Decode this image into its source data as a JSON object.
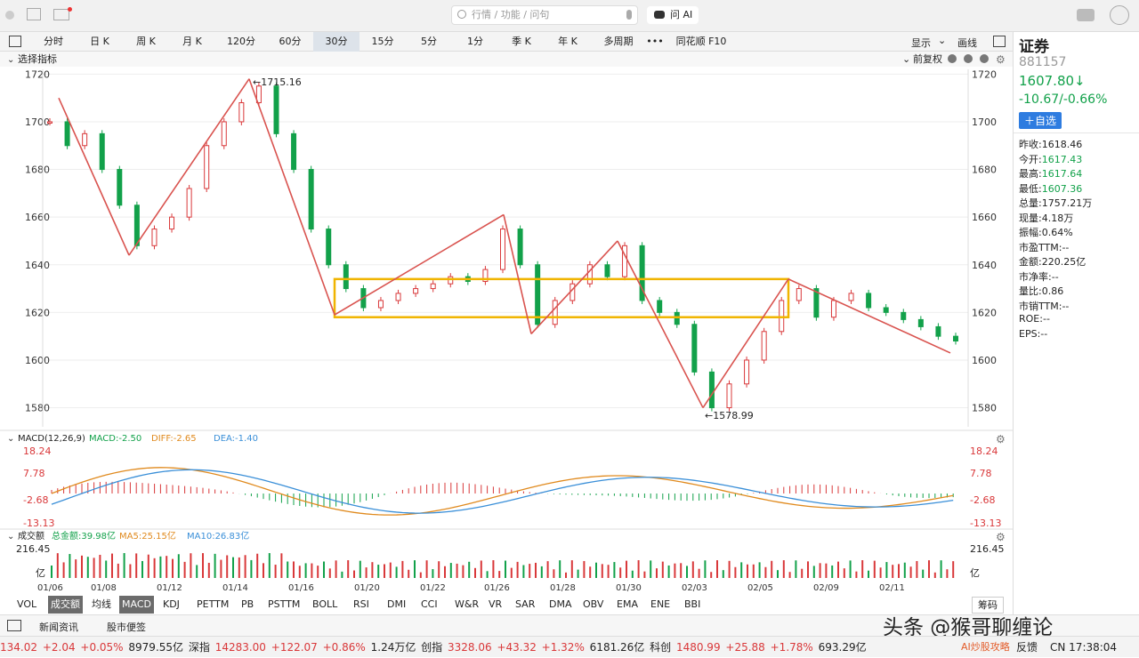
{
  "toolbar": {
    "search_placeholder": "行情 / 功能 / 问句",
    "ask_ai": "问 AI"
  },
  "period_tabs": [
    "分时",
    "日 K",
    "周 K",
    "月 K",
    "120分",
    "60分",
    "30分",
    "15分",
    "5分",
    "1分",
    "季 K",
    "年 K",
    "多周期",
    "•••",
    "同花顺 F10"
  ],
  "active_tab": "30分",
  "tab_right": {
    "display": "显示",
    "draw": "画线"
  },
  "indicator_bar": {
    "select": "选择指标",
    "fuquan": "前复权"
  },
  "stock": {
    "name": "证券",
    "code": "881157",
    "price": "1607.80↓",
    "change": "-10.67/-0.66%",
    "add_btn": "＋自选"
  },
  "quote": [
    {
      "label": "昨收:",
      "value": "1618.46",
      "color": "#222"
    },
    {
      "label": "今开:",
      "value": "1617.43",
      "color": "#12a14a"
    },
    {
      "label": "最高:",
      "value": "1617.64",
      "color": "#12a14a"
    },
    {
      "label": "最低:",
      "value": "1607.36",
      "color": "#12a14a"
    },
    {
      "label": "总量:",
      "value": "1757.21万",
      "color": "#222"
    },
    {
      "label": "现量:",
      "value": "4.18万",
      "color": "#222"
    },
    {
      "label": "振幅:",
      "value": "0.64%",
      "color": "#222"
    },
    {
      "label": "市盈TTM:",
      "value": "--",
      "color": "#222"
    },
    {
      "label": "金额:",
      "value": "220.25亿",
      "color": "#222"
    },
    {
      "label": "市净率:",
      "value": "--",
      "color": "#222"
    },
    {
      "label": "量比:",
      "value": "0.86",
      "color": "#222"
    },
    {
      "label": "市销TTM:",
      "value": "--",
      "color": "#222"
    },
    {
      "label": "ROE:",
      "value": "--",
      "color": "#222"
    },
    {
      "label": "EPS:",
      "value": "--",
      "color": "#222"
    }
  ],
  "chart_data": [
    {
      "type": "candlestick",
      "title": "",
      "y_ticks": [
        1580,
        1600,
        1620,
        1640,
        1660,
        1680,
        1700,
        1720
      ],
      "ylim": [
        1572,
        1722
      ],
      "annotations": {
        "high": "←1715.16",
        "low": "←1578.99"
      },
      "x_dates": [
        "01/06",
        "01/08",
        "01/12",
        "01/14",
        "01/16",
        "01/20",
        "01/22",
        "01/26",
        "01/28",
        "01/30",
        "02/03",
        "02/05",
        "02/09",
        "02/11"
      ],
      "close_path": [
        1700,
        1690,
        1695,
        1680,
        1665,
        1648,
        1655,
        1660,
        1672,
        1690,
        1700,
        1708,
        1715,
        1695,
        1680,
        1655,
        1640,
        1630,
        1622,
        1625,
        1628,
        1630,
        1632,
        1635,
        1633,
        1638,
        1655,
        1640,
        1615,
        1625,
        1632,
        1640,
        1635,
        1648,
        1625,
        1620,
        1615,
        1595,
        1580,
        1590,
        1600,
        1612,
        1625,
        1630,
        1618,
        1625,
        1628,
        1622,
        1620,
        1617,
        1614,
        1610,
        1608
      ]
    },
    {
      "type": "line",
      "title": "MACD(12,26,9)",
      "legend": [
        {
          "name": "MACD:-2.50",
          "color": "#12a14a"
        },
        {
          "name": "DIFF:-2.65",
          "color": "#e08a1e"
        },
        {
          "name": "DEA:-1.40",
          "color": "#3a8fd8"
        }
      ],
      "y_ticks": [
        18.24,
        7.78,
        -2.68,
        -13.13
      ]
    },
    {
      "type": "bar",
      "title": "成交额",
      "legend": [
        {
          "name": "总金额:39.98亿",
          "color": "#12a14a"
        },
        {
          "name": "MA5:25.15亿",
          "color": "#e08a1e"
        },
        {
          "name": "MA10:26.83亿",
          "color": "#3a8fd8"
        }
      ],
      "y_ticks": [
        "216.45",
        "亿"
      ]
    }
  ],
  "indicator_tabs": [
    "VOL",
    "成交额",
    "均线",
    "MACD",
    "KDJ",
    "PETTM",
    "PB",
    "PSTTM",
    "BOLL",
    "RSI",
    "DMI",
    "CCI",
    "W&R",
    "VR",
    "SAR",
    "DMA",
    "OBV",
    "EMA",
    "ENE",
    "BBI"
  ],
  "chip": "筹码",
  "news_tabs": [
    "新闻资讯",
    "股市便签"
  ],
  "watermark": "头条 @猴哥聊缠论",
  "ticker": [
    {
      "text": "134.02",
      "color": "#d9383a"
    },
    {
      "text": "+2.04",
      "color": "#d9383a"
    },
    {
      "text": "+0.05%",
      "color": "#d9383a"
    },
    {
      "text": "8979.55亿",
      "color": "#222"
    },
    {
      "text": "深指",
      "color": "#222"
    },
    {
      "text": "14283.00",
      "color": "#d9383a"
    },
    {
      "text": "+122.07",
      "color": "#d9383a"
    },
    {
      "text": "+0.86%",
      "color": "#d9383a"
    },
    {
      "text": "1.24万亿",
      "color": "#222"
    },
    {
      "text": "创指",
      "color": "#222"
    },
    {
      "text": "3328.06",
      "color": "#d9383a"
    },
    {
      "text": "+43.32",
      "color": "#d9383a"
    },
    {
      "text": "+1.32%",
      "color": "#d9383a"
    },
    {
      "text": "6181.26亿",
      "color": "#222"
    },
    {
      "text": "科创",
      "color": "#222"
    },
    {
      "text": "1480.99",
      "color": "#d9383a"
    },
    {
      "text": "+25.88",
      "color": "#d9383a"
    },
    {
      "text": "+1.78%",
      "color": "#d9383a"
    },
    {
      "text": "693.29亿",
      "color": "#222"
    }
  ],
  "ticker_right": {
    "ai": "AI炒股攻略",
    "feedback": "反馈",
    "time": "CN 17:38:04"
  }
}
